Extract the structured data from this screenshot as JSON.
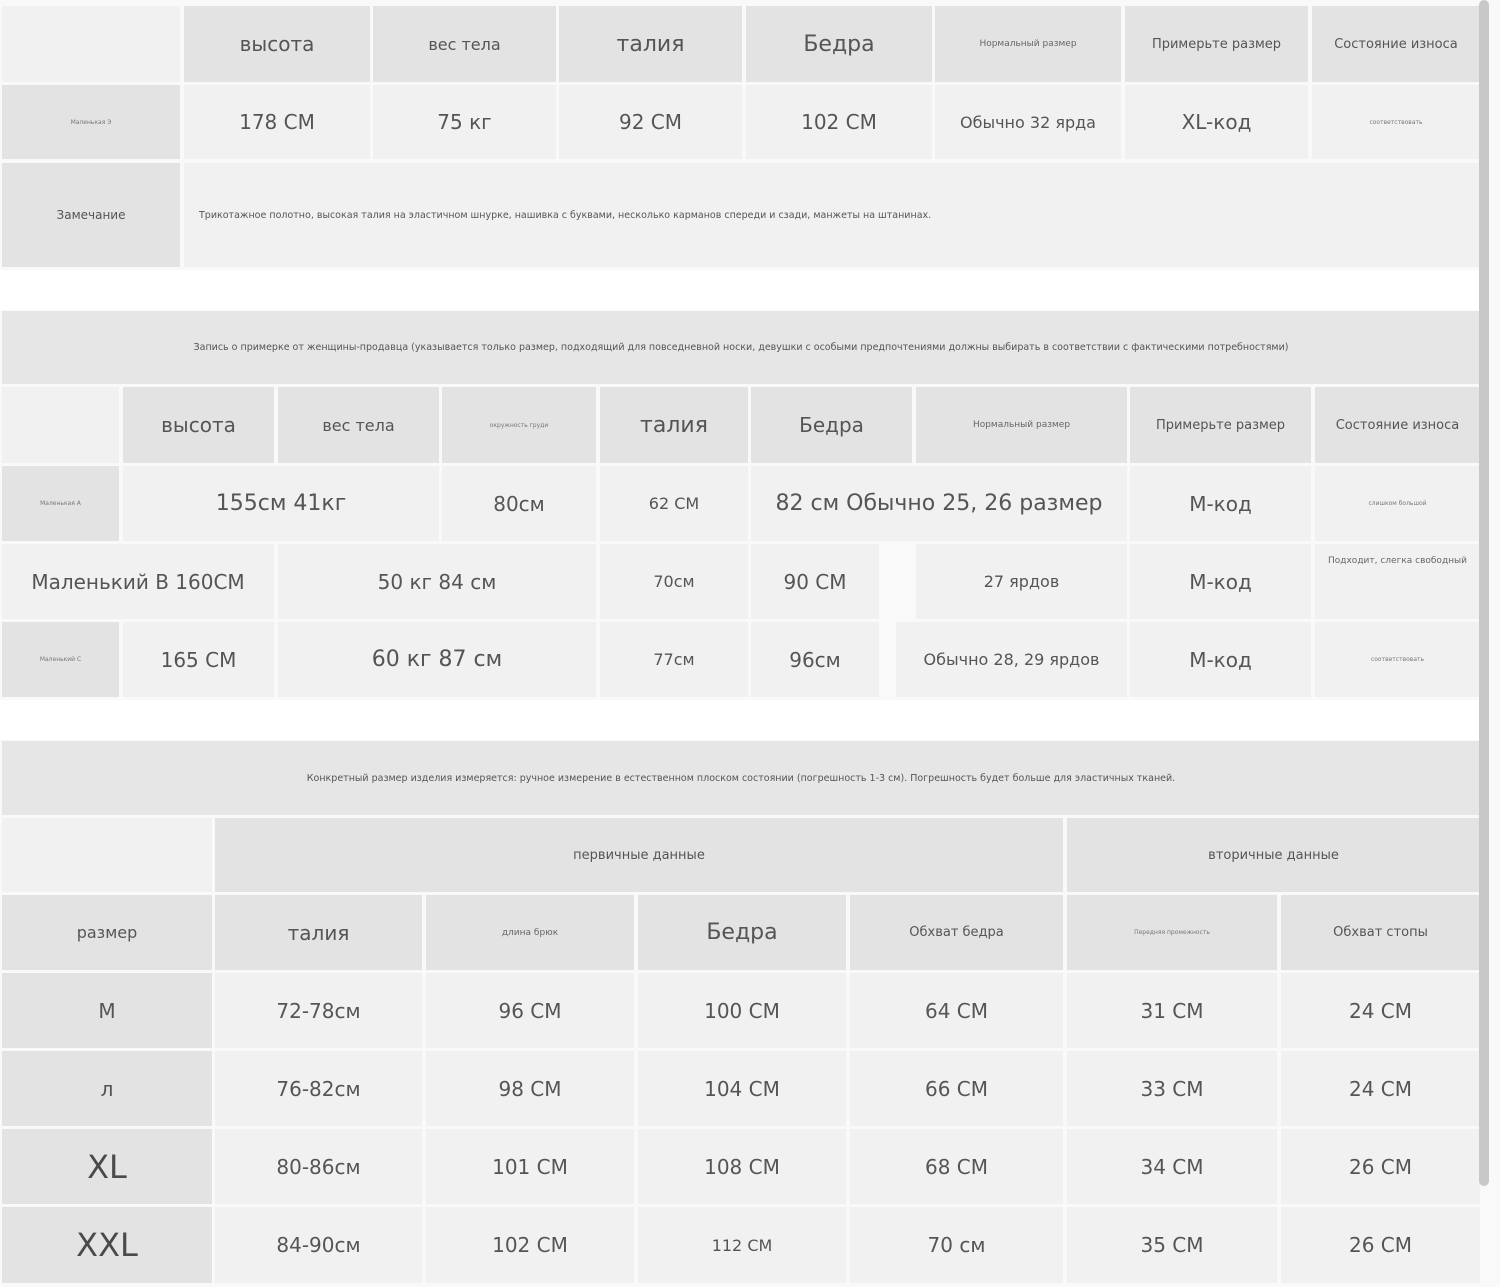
{
  "table1": {
    "headers": [
      "высота",
      "вес тела",
      "талия",
      "Бедра",
      "Нормальный размер",
      "Примерьте размер",
      "Состояние износа"
    ],
    "row": {
      "label": "Маленькая Э",
      "values": [
        "178 СМ",
        "75 кг",
        "92 СМ",
        "102 СМ",
        "Обычно 32 ярда",
        "XL-код",
        "соответствовать"
      ]
    },
    "remark_label": "Замечание",
    "remark_text": "Трикотажное полотно, высокая талия на эластичном шнурке, нашивка с буквами, несколько карманов спереди и сзади, манжеты на штанинах."
  },
  "table2": {
    "caption": "Запись о примерке от женщины-продавца (указывается только размер, подходящий для повседневной носки, девушки с особыми предпочтениями должны выбирать в соответствии с фактическими потребностями)",
    "headers": [
      "высота",
      "вес тела",
      "окружность груди",
      "талия",
      "Бедра",
      "Нормальный размер",
      "Примерьте размер",
      "Состояние износа"
    ],
    "rows": [
      {
        "label": "Маленькая А",
        "height_weight": "155см 41кг",
        "bust": "80см",
        "waist": "62 СМ",
        "hips_size": "82 см Обычно 25, 26 размер",
        "try": "М-код",
        "wear": "слишком большой"
      },
      {
        "label_value": "Маленький В 160СМ",
        "weight_bust": "50 кг 84 см",
        "waist": "70см",
        "hips": "90 СМ",
        "size": "27 ярдов",
        "try": "М-код",
        "wear": "Подходит, слегка свободный"
      },
      {
        "label": "Маленький С",
        "height": "165 СМ",
        "weight_bust": "60 кг 87 см",
        "waist": "77см",
        "hips": "96см",
        "size": "Обычно 28, 29 ярдов",
        "try": "М-код",
        "wear": "соответствовать"
      }
    ]
  },
  "table3": {
    "caption": "Конкретный размер изделия измеряется: ручное измерение в естественном плоском состоянии (погрешность 1-3 см). Погрешность будет больше для эластичных тканей.",
    "group_primary": "первичные данные",
    "group_secondary": "вторичные данные",
    "headers": [
      "размер",
      "талия",
      "длина брюк",
      "Бедра",
      "Обхват бедра",
      "Передняя промежность",
      "Обхват стопы"
    ],
    "rows": [
      [
        "М",
        "72-78см",
        "96 СМ",
        "100 СМ",
        "64 СМ",
        "31 СМ",
        "24 СМ"
      ],
      [
        "л",
        "76-82см",
        "98 СМ",
        "104 СМ",
        "66 СМ",
        "33 СМ",
        "24 СМ"
      ],
      [
        "XL",
        "80-86см",
        "101 СМ",
        "108 СМ",
        "68 СМ",
        "34 СМ",
        "26 СМ"
      ],
      [
        "XXL",
        "84-90см",
        "102 СМ",
        "112 СМ",
        "70 см",
        "35 СМ",
        "26 СМ"
      ]
    ]
  }
}
